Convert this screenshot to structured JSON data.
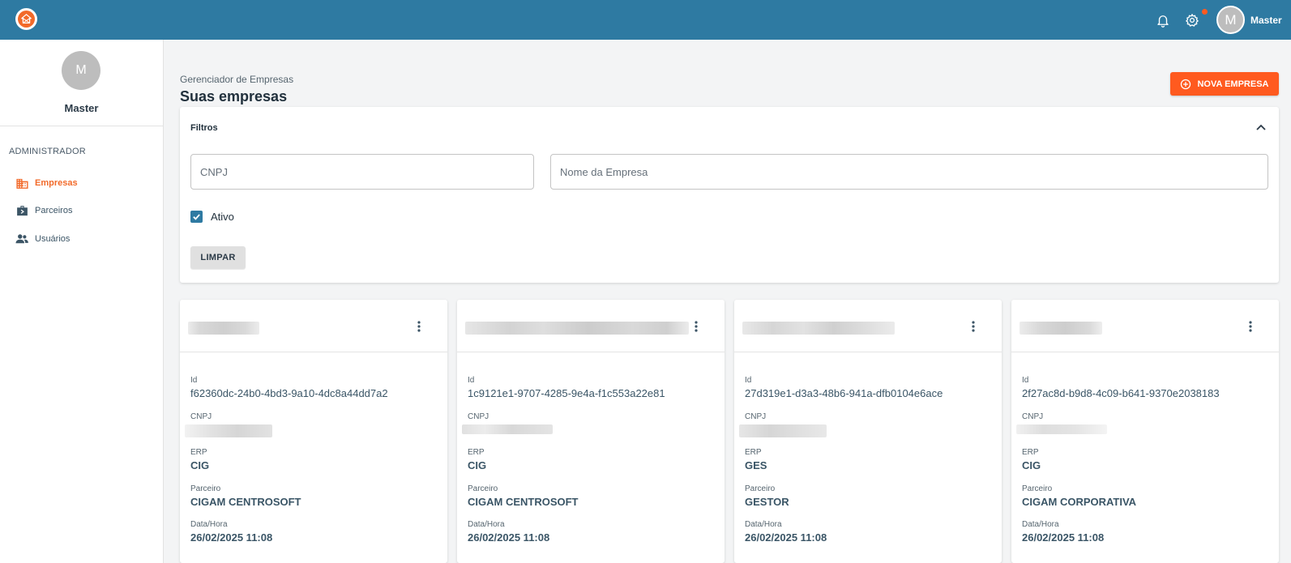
{
  "header": {
    "user_initial": "M",
    "user_name": "Master",
    "icons": [
      "logo-icon",
      "bell-icon",
      "gear-icon"
    ],
    "brand_color": "#2e7aa2",
    "accent_color": "#ff5a1f"
  },
  "sidebar": {
    "avatar_initial": "M",
    "user_name": "Master",
    "section_title": "ADMINISTRADOR",
    "items": [
      {
        "label": "Empresas",
        "icon": "buildings-icon",
        "active": true
      },
      {
        "label": "Parceiros",
        "icon": "briefcase-icon",
        "active": false
      },
      {
        "label": "Usuários",
        "icon": "people-icon",
        "active": false
      }
    ]
  },
  "main": {
    "breadcrumb": "Gerenciador de Empresas",
    "title": "Suas empresas",
    "new_button_label": "NOVA EMPRESA"
  },
  "filters": {
    "title": "Filtros",
    "cnpj_placeholder": "CNPJ",
    "nome_placeholder": "Nome da Empresa",
    "ativo_label": "Ativo",
    "ativo_checked": true,
    "clear_label": "LIMPAR"
  },
  "card_labels": {
    "id": "Id",
    "cnpj": "CNPJ",
    "erp": "ERP",
    "parceiro": "Parceiro",
    "datahora": "Data/Hora"
  },
  "cards": [
    {
      "id": "f62360dc-24b0-4bd3-9a10-4dc8a44dd7a2",
      "erp": "CIG",
      "parceiro": "CIGAM CENTROSOFT",
      "datahora": "26/02/2025 11:08"
    },
    {
      "id": "1c9121e1-9707-4285-9e4a-f1c553a22e81",
      "erp": "CIG",
      "parceiro": "CIGAM CENTROSOFT",
      "datahora": "26/02/2025 11:08"
    },
    {
      "id": "27d319e1-d3a3-48b6-941a-dfb0104e6ace",
      "erp": "GES",
      "parceiro": "GESTOR",
      "datahora": "26/02/2025 11:08"
    },
    {
      "id": "2f27ac8d-b9d8-4c09-b641-9370e2038183",
      "erp": "CIG",
      "parceiro": "CIGAM CORPORATIVA",
      "datahora": "26/02/2025 11:08"
    }
  ]
}
